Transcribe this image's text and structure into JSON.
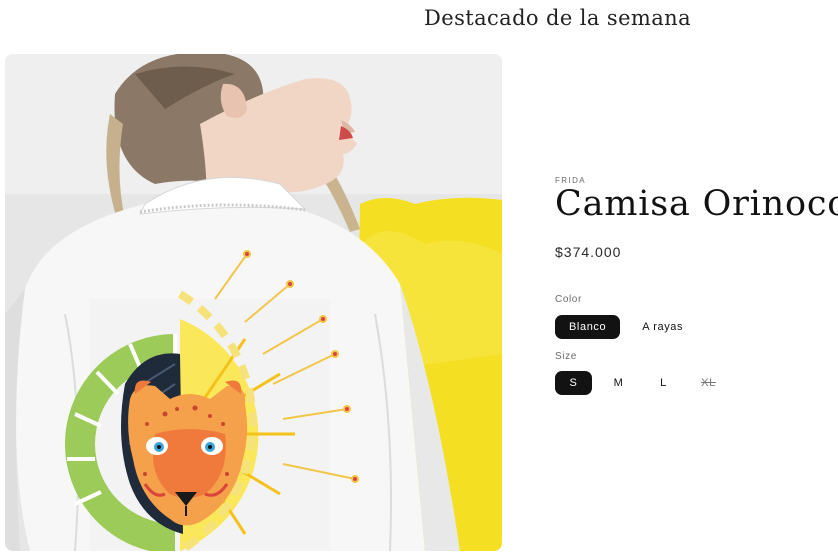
{
  "section": {
    "title": "Destacado de la semana"
  },
  "product": {
    "vendor": "FRIDA",
    "title": "Camisa Orinoco",
    "price": "$374.000",
    "image_alt": "Camisa blanca con estampado de jaguar"
  },
  "options": {
    "color": {
      "label": "Color",
      "values": [
        "Blanco",
        "A rayas"
      ],
      "selected": "Blanco"
    },
    "size": {
      "label": "Size",
      "values": [
        "S",
        "M",
        "L",
        "XL"
      ],
      "selected": "S",
      "unavailable": [
        "XL"
      ]
    }
  },
  "colors": {
    "accent": "#121212",
    "yellow": "#f6e22a",
    "orange": "#f08a3c"
  }
}
